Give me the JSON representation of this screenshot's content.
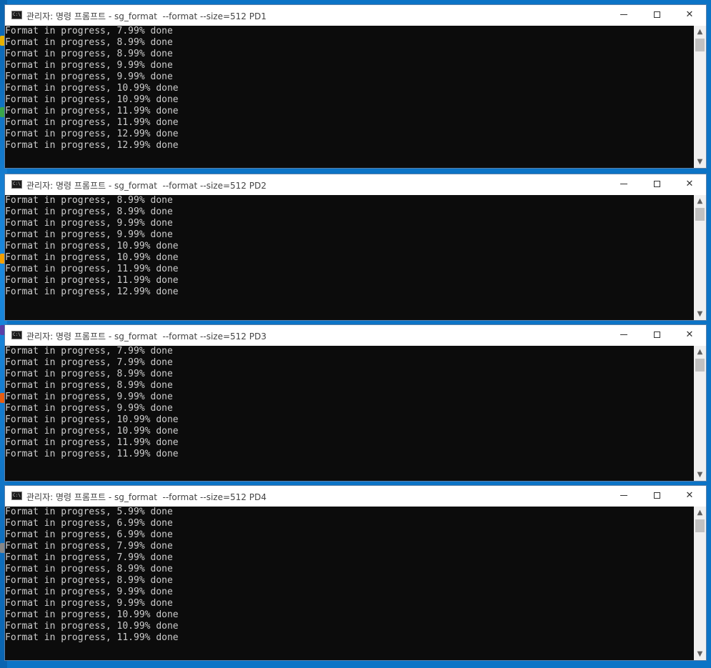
{
  "colors": {
    "desktop": "#0c74c6",
    "console_bg": "#0c0c0c",
    "console_text": "#cccccc",
    "titlebar_bg": "#ffffff"
  },
  "windows": [
    {
      "title": "관리자: 명령 프롬프트 - sg_format  --format --size=512 PD1",
      "lines": [
        "Format in progress, 7.99% done",
        "Format in progress, 8.99% done",
        "Format in progress, 8.99% done",
        "Format in progress, 9.99% done",
        "Format in progress, 9.99% done",
        "Format in progress, 10.99% done",
        "Format in progress, 10.99% done",
        "Format in progress, 11.99% done",
        "Format in progress, 11.99% done",
        "Format in progress, 12.99% done",
        "Format in progress, 12.99% done"
      ]
    },
    {
      "title": "관리자: 명령 프롬프트 - sg_format  --format --size=512 PD2",
      "lines": [
        "Format in progress, 8.99% done",
        "Format in progress, 8.99% done",
        "Format in progress, 9.99% done",
        "Format in progress, 9.99% done",
        "Format in progress, 10.99% done",
        "Format in progress, 10.99% done",
        "Format in progress, 11.99% done",
        "Format in progress, 11.99% done",
        "Format in progress, 12.99% done"
      ]
    },
    {
      "title": "관리자: 명령 프롬프트 - sg_format  --format --size=512 PD3",
      "lines": [
        "Format in progress, 7.99% done",
        "Format in progress, 7.99% done",
        "Format in progress, 8.99% done",
        "Format in progress, 8.99% done",
        "Format in progress, 9.99% done",
        "Format in progress, 9.99% done",
        "Format in progress, 10.99% done",
        "Format in progress, 10.99% done",
        "Format in progress, 11.99% done",
        "Format in progress, 11.99% done"
      ]
    },
    {
      "title": "관리자: 명령 프롬프트 - sg_format  --format --size=512 PD4",
      "lines": [
        "Format in progress, 5.99% done",
        "Format in progress, 6.99% done",
        "Format in progress, 6.99% done",
        "Format in progress, 7.99% done",
        "Format in progress, 7.99% done",
        "Format in progress, 8.99% done",
        "Format in progress, 8.99% done",
        "Format in progress, 9.99% done",
        "Format in progress, 9.99% done",
        "Format in progress, 10.99% done",
        "Format in progress, 10.99% done",
        "Format in progress, 11.99% done"
      ]
    }
  ],
  "controls": {
    "minimize_icon": "minimize-icon",
    "maximize_icon": "maximize-icon",
    "close_glyph": "✕",
    "scroll_up_glyph": "▲",
    "scroll_down_glyph": "▼",
    "app_icon_text": "C:\\"
  }
}
